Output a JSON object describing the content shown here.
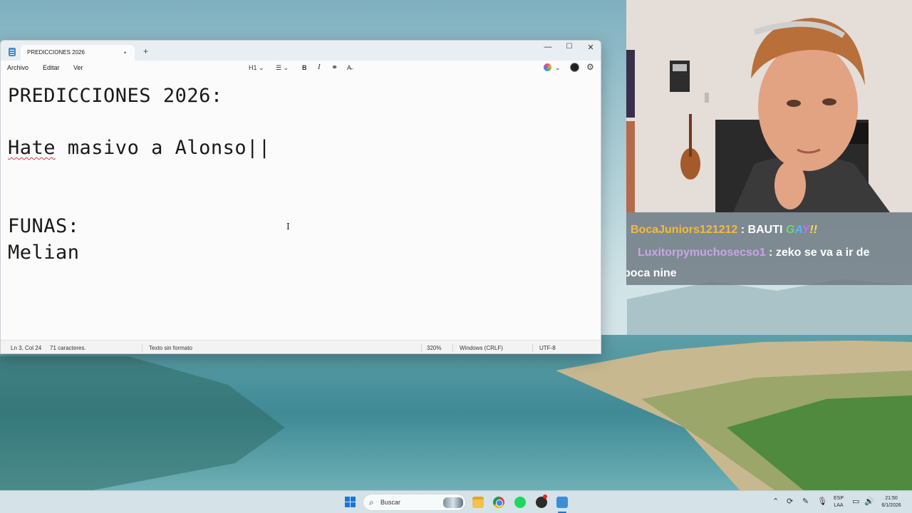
{
  "notepad": {
    "tab_title": "PREDICCIONES 2026",
    "tab_unsaved": "•",
    "tab_add": "+",
    "controls": {
      "minimize": "—",
      "maximize": "☐",
      "close": "✕"
    },
    "menu": {
      "file": "Archivo",
      "edit": "Editar",
      "view": "Ver"
    },
    "toolbar": {
      "heading": "H1 ⌄",
      "list": "☰ ⌄",
      "bold": "B",
      "italic": "I",
      "link": "⚭",
      "clear_format": "A̶",
      "copilot_chevron": "⌄",
      "settings": "⚙"
    },
    "content": {
      "line1": "PREDICCIONES 2026:",
      "line3_word": "Hate",
      "line3_rest": " masivo a Alonso||",
      "line6": "FUNAS:",
      "line7": "Melian"
    },
    "cursor_glyph": "I",
    "status": {
      "position": "Ln 3, Col 24",
      "chars": "71 caracteres.",
      "format": "Texto sin formato",
      "zoom": "320%",
      "line_ending": "Windows (CRLF)",
      "encoding": "UTF-8"
    }
  },
  "chat": {
    "messages": [
      {
        "user": "BocaJuniors121212",
        "sep": " : ",
        "text": "BAUTI ",
        "emote": [
          "G",
          "A",
          "Y",
          "!",
          "!"
        ]
      },
      {
        "user": "Luxitorpymuchosecso1",
        "sep": " : ",
        "text": "zeko se va a ir de",
        "text2": "boca nine"
      }
    ],
    "colors": {
      "user1": "#f5b93b",
      "user2": "#c9a4e6"
    }
  },
  "taskbar": {
    "search_placeholder": "Buscar",
    "search_icon": "⌕",
    "tray": {
      "chevron": "⌃",
      "lang_top": "ESP",
      "lang_bottom": "LAA",
      "time": "21:50",
      "date": "6/1/2026"
    },
    "icons": [
      "start-icon",
      "search-icon",
      "file-explorer-icon",
      "chrome-icon",
      "spotify-icon",
      "obs-icon",
      "notepad-icon"
    ]
  }
}
